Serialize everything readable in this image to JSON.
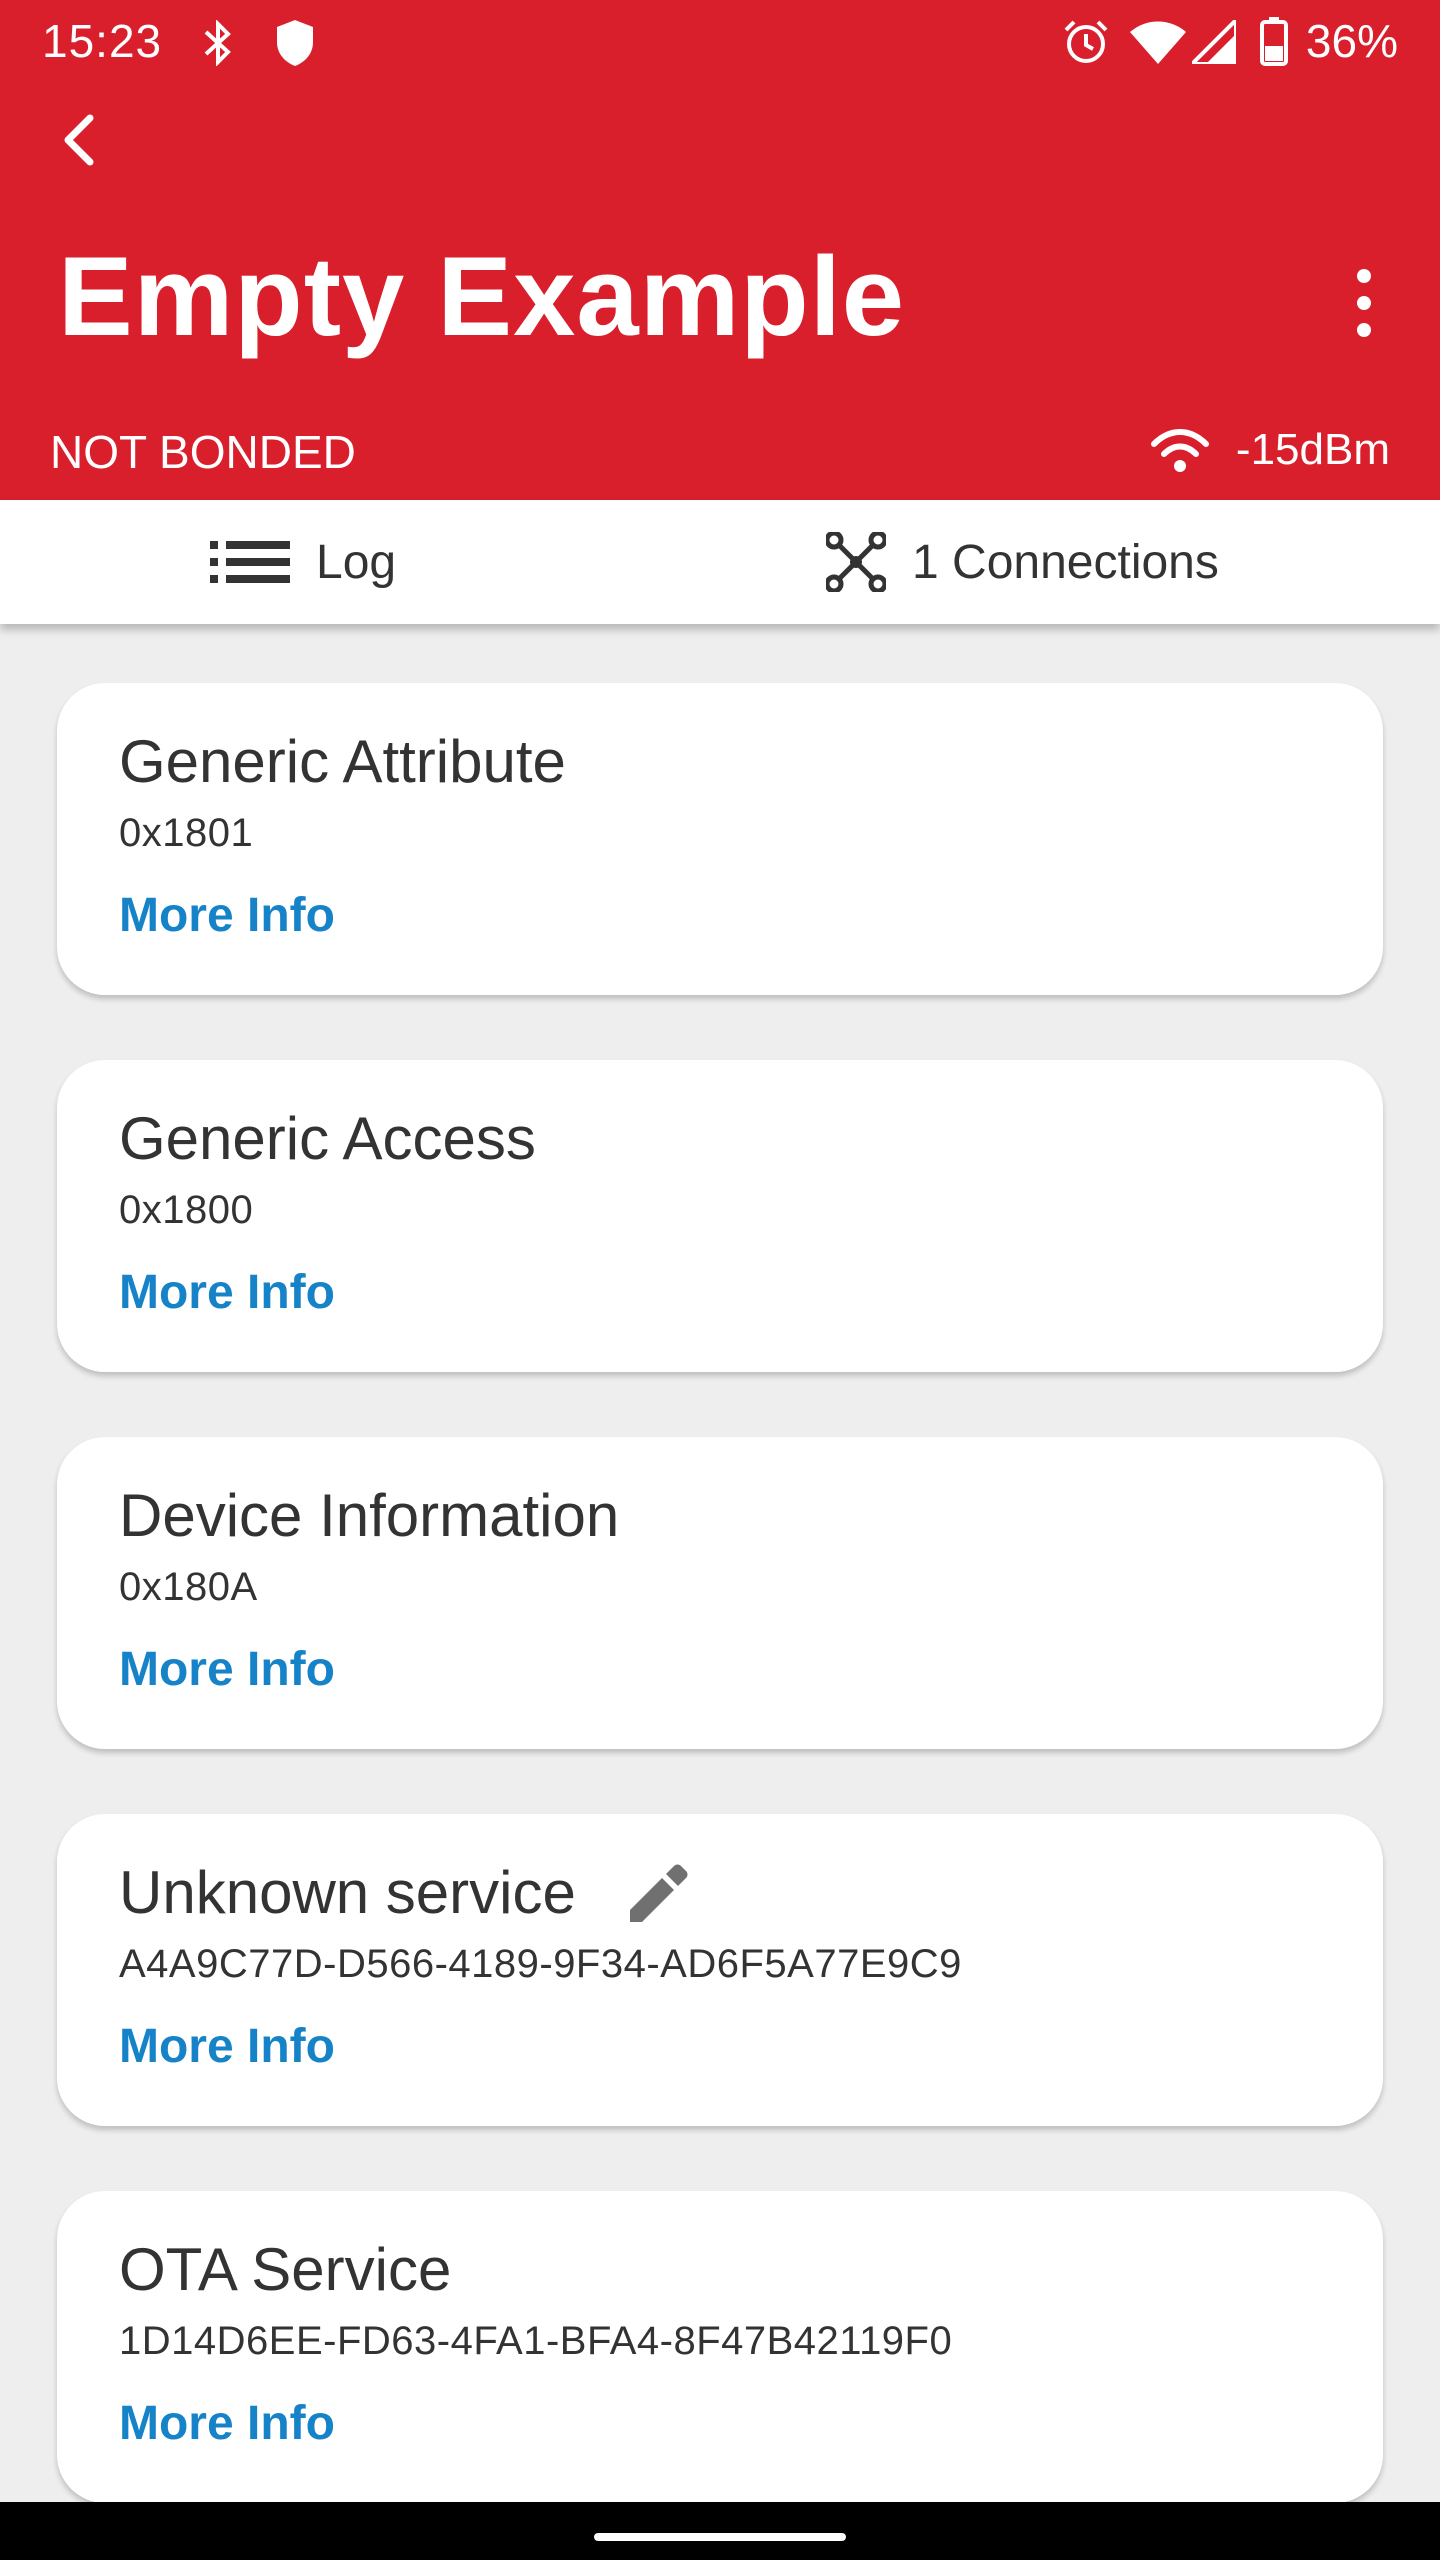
{
  "status_bar": {
    "time": "15:23",
    "battery": "36%",
    "icons": [
      "bluetooth-icon",
      "shield-icon",
      "alarm-icon",
      "wifi-icon",
      "cell-signal-icon",
      "battery-icon"
    ]
  },
  "header": {
    "title": "Empty Example",
    "bond_status": "NOT BONDED",
    "rssi": "-15dBm",
    "colors": {
      "background": "#d91e2c",
      "text": "#ffffff"
    }
  },
  "tabs": [
    {
      "label": "Log",
      "icon": "list-icon"
    },
    {
      "label": "1 Connections",
      "icon": "connections-icon"
    }
  ],
  "services": [
    {
      "name": "Generic Attribute",
      "uuid": "0x1801",
      "link": "More Info",
      "editable": false
    },
    {
      "name": "Generic Access",
      "uuid": "0x1800",
      "link": "More Info",
      "editable": false
    },
    {
      "name": "Device Information",
      "uuid": "0x180A",
      "link": "More Info",
      "editable": false
    },
    {
      "name": "Unknown service",
      "uuid": "A4A9C77D-D566-4189-9F34-AD6F5A77E9C9",
      "link": "More Info",
      "editable": true
    },
    {
      "name": "OTA Service",
      "uuid": "1D14D6EE-FD63-4FA1-BFA4-8F47B42119F0",
      "link": "More Info",
      "editable": false
    }
  ],
  "colors": {
    "link": "#1683c8",
    "page_background": "#eeeeee"
  }
}
